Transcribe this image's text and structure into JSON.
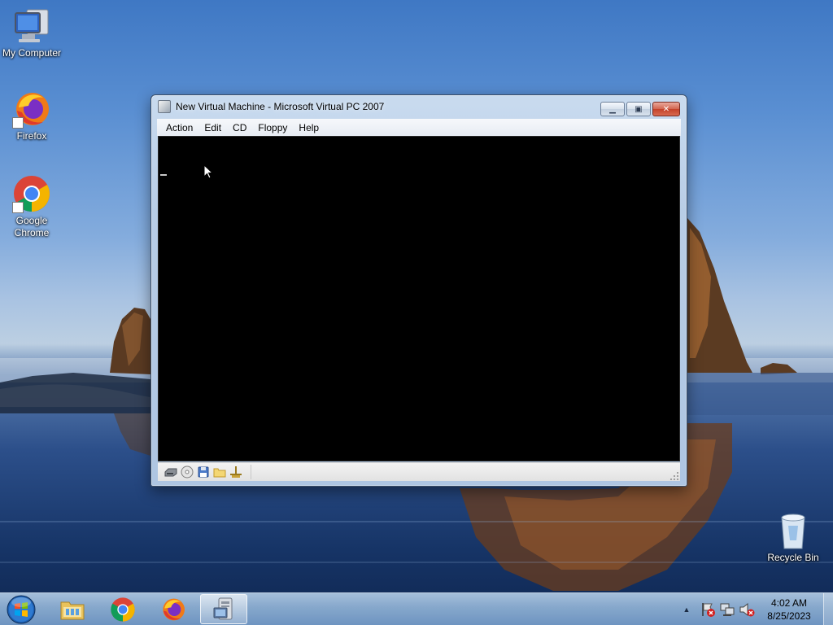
{
  "desktop": {
    "icons": [
      {
        "label": "My Computer"
      },
      {
        "label": "Firefox"
      },
      {
        "label": "Google Chrome"
      },
      {
        "label": "Recycle Bin"
      }
    ]
  },
  "window": {
    "title": "New Virtual Machine - Microsoft Virtual PC 2007",
    "menu": [
      "Action",
      "Edit",
      "CD",
      "Floppy",
      "Help"
    ],
    "status_icons": [
      "hard-disk-icon",
      "cd-drive-icon",
      "floppy-icon",
      "shared-folder-icon",
      "network-icon"
    ]
  },
  "taskbar": {
    "pinned": [
      "file-explorer-icon",
      "chrome-icon",
      "firefox-icon",
      "virtual-pc-icon"
    ],
    "active": "virtual-pc-icon",
    "clock": {
      "time": "4:02 AM",
      "date": "8/25/2023"
    }
  },
  "colors": {
    "vm_screen": "#000000",
    "close_button": "#c4422a",
    "accent": "#3f78c4"
  }
}
